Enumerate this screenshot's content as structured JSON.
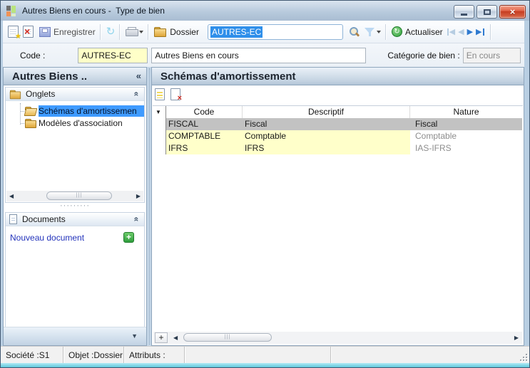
{
  "window": {
    "title": "Autres Biens en cours -  Type de bien"
  },
  "toolbar": {
    "save_label": "Enregistrer",
    "dossier_label": "Dossier",
    "code_field_value": "AUTRES-EC",
    "actualiser_label": "Actualiser"
  },
  "form": {
    "code_label": "Code :",
    "code_value": "AUTRES-EC",
    "designation_value": "Autres Biens en cours",
    "categorie_label": "Catégorie de bien :",
    "categorie_value": "En cours"
  },
  "sidebar": {
    "title": "Autres Biens ..",
    "onglets": {
      "label": "Onglets",
      "items": [
        {
          "label": "Schémas d'amortissemen",
          "selected": true
        },
        {
          "label": "Modèles d'association",
          "selected": false
        }
      ]
    },
    "documents": {
      "label": "Documents",
      "new_document_label": "Nouveau document"
    }
  },
  "main": {
    "title": "Schémas d'amortissement",
    "table": {
      "columns": [
        "Code",
        "Descriptif",
        "Nature"
      ],
      "rows": [
        {
          "code": "FISCAL",
          "descriptif": "Fiscal",
          "nature": "Fiscal",
          "selected": true
        },
        {
          "code": "COMPTABLE",
          "descriptif": "Comptable",
          "nature": "Comptable",
          "selected": false
        },
        {
          "code": "IFRS",
          "descriptif": "IFRS",
          "nature": "IAS-IFRS",
          "selected": false
        }
      ]
    }
  },
  "statusbar": {
    "societe": "Société :S1",
    "objet": "Objet :Dossier",
    "attributs": "Attributs :"
  },
  "icons": {
    "dropdown": "▼",
    "chevrons_up": "«",
    "collapse_left": "«",
    "star": "★",
    "cross": "×",
    "refresh": "↻",
    "plus": "+",
    "arrow_left": "◀",
    "arrow_right": "▶",
    "grip_dots": "·········"
  },
  "colors": {
    "selection_blue": "#3f9bff",
    "row_selected_gray": "#c2c2c2",
    "field_yellow": "#ffffc8",
    "accent_cyan": "#5fc9dc",
    "close_red": "#c53b20"
  }
}
